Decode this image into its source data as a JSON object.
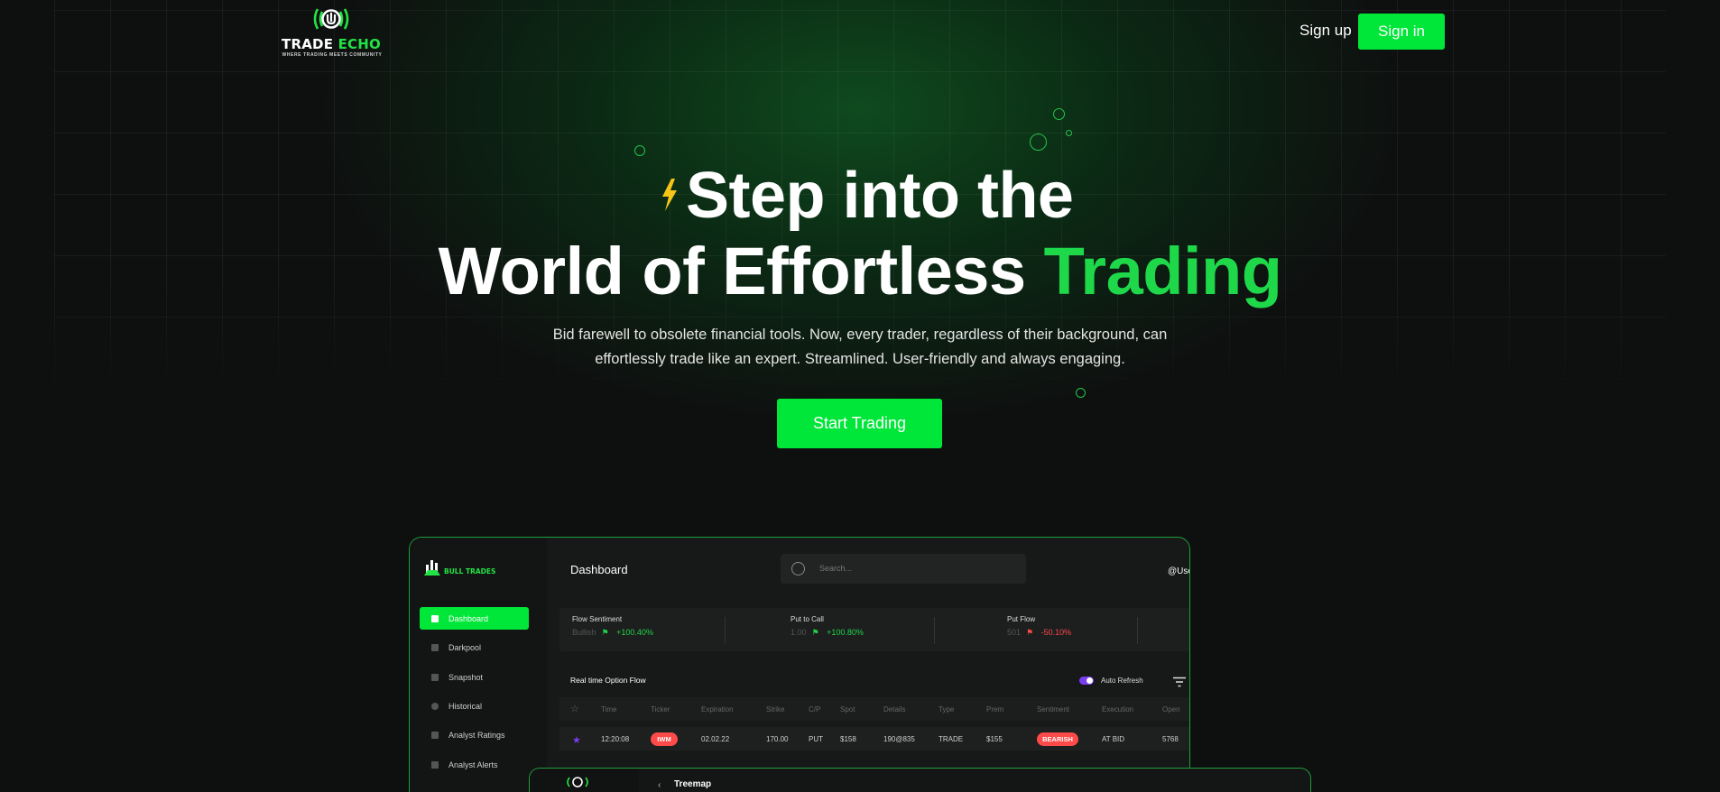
{
  "header": {
    "logo": {
      "word1": "TRADE",
      "word2": "ECHO",
      "tagline": "WHERE TRADING MEETS COMMUNITY"
    },
    "signup_label": "Sign up",
    "signin_label": "Sign in"
  },
  "hero": {
    "line1": "Step into the",
    "line2_plain": "World of Effortless",
    "line2_accent": "Trading",
    "subtext": "Bid farewell to obsolete financial tools. Now, every trader, regardless of their background, can effortlessly trade like an expert. Streamlined. User-friendly and always engaging.",
    "cta_label": "Start Trading"
  },
  "dashboard": {
    "brand": "BULL TRADES",
    "title": "Dashboard",
    "search_placeholder": "Search...",
    "user": "@Use",
    "nav": [
      {
        "label": "Dashboard",
        "icon": "grid-icon",
        "active": true
      },
      {
        "label": "Darkpool",
        "icon": "pen-icon",
        "active": false
      },
      {
        "label": "Snapshot",
        "icon": "bar-chart-icon",
        "active": false
      },
      {
        "label": "Historical",
        "icon": "clock-icon",
        "active": false
      },
      {
        "label": "Analyst Ratings",
        "icon": "people-icon",
        "active": false
      },
      {
        "label": "Analyst Alerts",
        "icon": "bell-icon",
        "active": false
      }
    ],
    "stats": [
      {
        "label": "Flow Sentiment",
        "value": "Bullish",
        "change": "+100.40%",
        "direction": "up"
      },
      {
        "label": "Put to Call",
        "value": "1.00",
        "change": "+100.80%",
        "direction": "up"
      },
      {
        "label": "Put Flow",
        "value": "501",
        "change": "-50.10%",
        "direction": "down"
      }
    ],
    "flow_title": "Real time Option Flow",
    "auto_refresh_label": "Auto Refresh",
    "columns": [
      "Time",
      "Ticker",
      "Expiration",
      "Strike",
      "C/P",
      "Spot",
      "Details",
      "Type",
      "Prem",
      "Sentiment",
      "Execution",
      "Open"
    ],
    "row": {
      "time": "12:20:08",
      "ticker": "IWM",
      "expiration": "02.02.22",
      "strike": "170.00",
      "cp": "PUT",
      "spot": "$158",
      "details": "190@835",
      "type": "TRADE",
      "prem": "$155",
      "sentiment": "BEARISH",
      "execution": "AT BID",
      "open": "5768"
    }
  },
  "second_card": {
    "title": "Treemap"
  },
  "colors": {
    "accent": "#00e639",
    "accent_text": "#1ed84a",
    "bear": "#ff4a4a",
    "toggle": "#7a3cf0"
  }
}
